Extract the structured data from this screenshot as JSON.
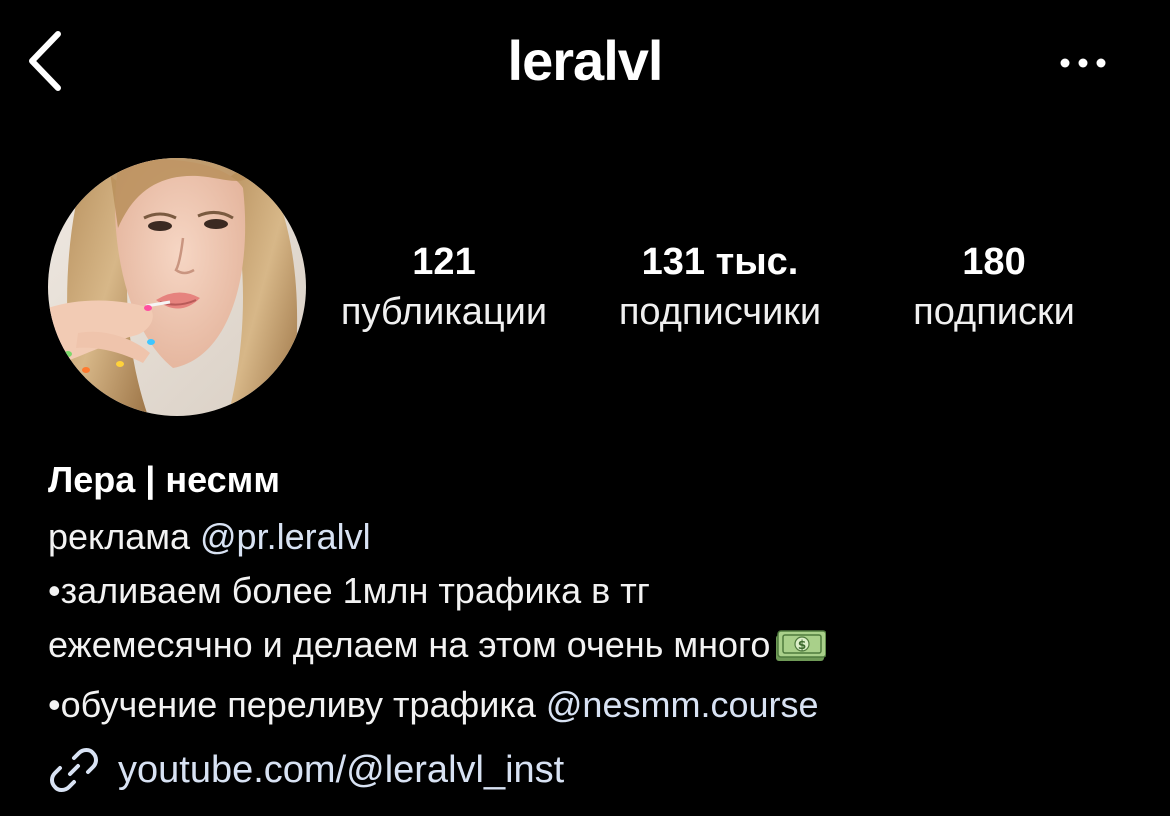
{
  "header": {
    "username": "leralvl",
    "back_icon": "chevron-left-icon",
    "more_icon": "ellipsis-icon"
  },
  "profile": {
    "avatar_alt": "profile-photo"
  },
  "stats": {
    "posts": {
      "value": "121",
      "label": "публикации"
    },
    "followers": {
      "value": "131 тыс.",
      "label": "подписчики"
    },
    "following": {
      "value": "180",
      "label": "подписки"
    }
  },
  "bio": {
    "name": "Лера | несмм",
    "line1_prefix": "реклама ",
    "line1_mention": "@pr.leralvl",
    "line2": "•заливаем более 1млн трафика в тг",
    "line3": "ежемесячно и делаем на этом очень много",
    "line3_emoji": "money-banknote-icon",
    "line4_prefix": "•обучение переливу трафика ",
    "line4_mention": "@nesmm.course"
  },
  "link": {
    "icon": "link-icon",
    "text": "youtube.com/@leralvl_inst"
  },
  "colors": {
    "background": "#000000",
    "text": "#f5f5f5",
    "link": "#d8e2f3",
    "emoji_green": "#8fbf6a"
  }
}
